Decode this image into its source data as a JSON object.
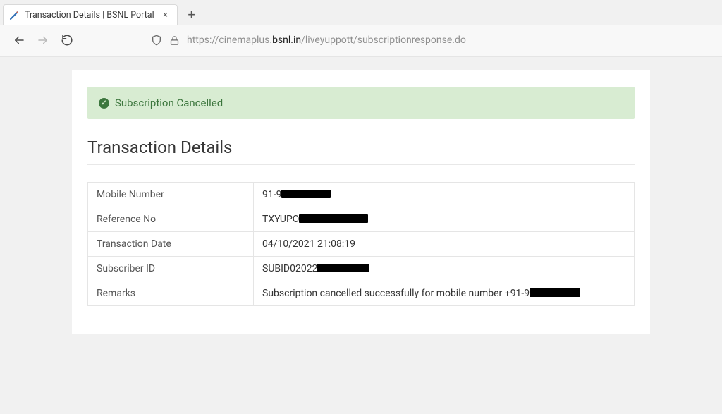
{
  "browser": {
    "tab_title": "Transaction Details | BSNL Portal",
    "url_pre": "https://cinemaplus.",
    "url_host": "bsnl.in",
    "url_post": "/liveyuppott/subscriptionresponse.do"
  },
  "alert": {
    "message": "Subscription Cancelled"
  },
  "title": "Transaction Details",
  "rows": {
    "mobile": {
      "label": "Mobile Number",
      "prefix": "91-9"
    },
    "refno": {
      "label": "Reference No",
      "prefix": "TXYUPO"
    },
    "txdate": {
      "label": "Transaction Date",
      "value": "04/10/2021 21:08:19"
    },
    "subid": {
      "label": "Subscriber ID",
      "prefix": "SUBID02022"
    },
    "remarks": {
      "label": "Remarks",
      "prefix": "Subscription cancelled successfully for mobile number +91-9"
    }
  }
}
